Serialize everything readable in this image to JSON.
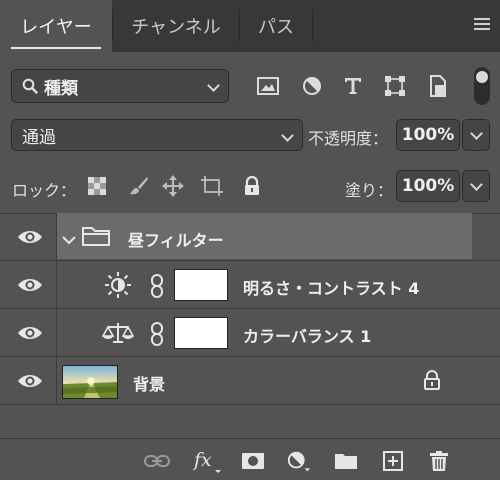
{
  "tabs": [
    {
      "label": "レイヤー",
      "active": true
    },
    {
      "label": "チャンネル",
      "active": false
    },
    {
      "label": "パス",
      "active": false
    }
  ],
  "filter": {
    "kind_label": "種類",
    "icons": [
      "image-filter-icon",
      "adjustment-filter-icon",
      "type-filter-icon",
      "shape-filter-icon",
      "smart-object-filter-icon"
    ]
  },
  "blend": {
    "mode_label": "通過",
    "opacity_label": "不透明度：",
    "opacity_value": "100%"
  },
  "lock": {
    "label": "ロック：",
    "icons": [
      "lock-transparent-pixels-icon",
      "lock-image-pixels-icon",
      "lock-position-icon",
      "lock-artboard-icon",
      "lock-all-icon"
    ],
    "fill_label": "塗り：",
    "fill_value": "100%"
  },
  "layers": [
    {
      "name": "昼フィルター",
      "type": "group",
      "expanded": true,
      "visible": true
    },
    {
      "name": "明るさ・コントラスト 4",
      "type": "adjustment",
      "icon": "brightness-contrast-icon",
      "visible": true
    },
    {
      "name": "カラーバランス 1",
      "type": "adjustment",
      "icon": "color-balance-icon",
      "visible": true
    },
    {
      "name": "背景",
      "type": "background",
      "locked": true,
      "visible": true
    }
  ],
  "bottom_icons": [
    "link-layers-icon",
    "fx-icon",
    "add-mask-icon",
    "new-adjustment-icon",
    "new-group-icon",
    "new-layer-icon",
    "delete-icon"
  ],
  "colors": {
    "panel": "#535353",
    "tabbar": "#383838",
    "selected_group": "#6b6b6b"
  }
}
